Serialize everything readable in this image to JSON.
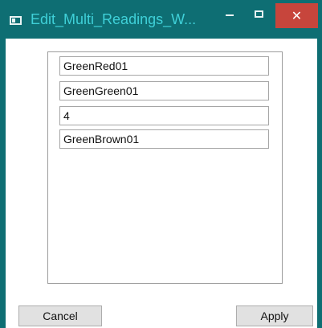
{
  "window": {
    "title": "Edit_Multi_Readings_W...",
    "icons": {
      "app": "app-window-icon",
      "minimize": "minimize-icon",
      "maximize": "maximize-icon",
      "close": "close-icon"
    },
    "close_glyph": "✕",
    "colors": {
      "titlebar": "#0e6e73",
      "title_text": "#3fd0d8",
      "close_button": "#c7453c"
    }
  },
  "form": {
    "fields": [
      {
        "value": "GreenRed01"
      },
      {
        "value": "GreenGreen01"
      },
      {
        "value": "4"
      },
      {
        "value": "GreenBrown01"
      }
    ]
  },
  "buttons": {
    "cancel_label": "Cancel",
    "apply_label": "Apply"
  }
}
